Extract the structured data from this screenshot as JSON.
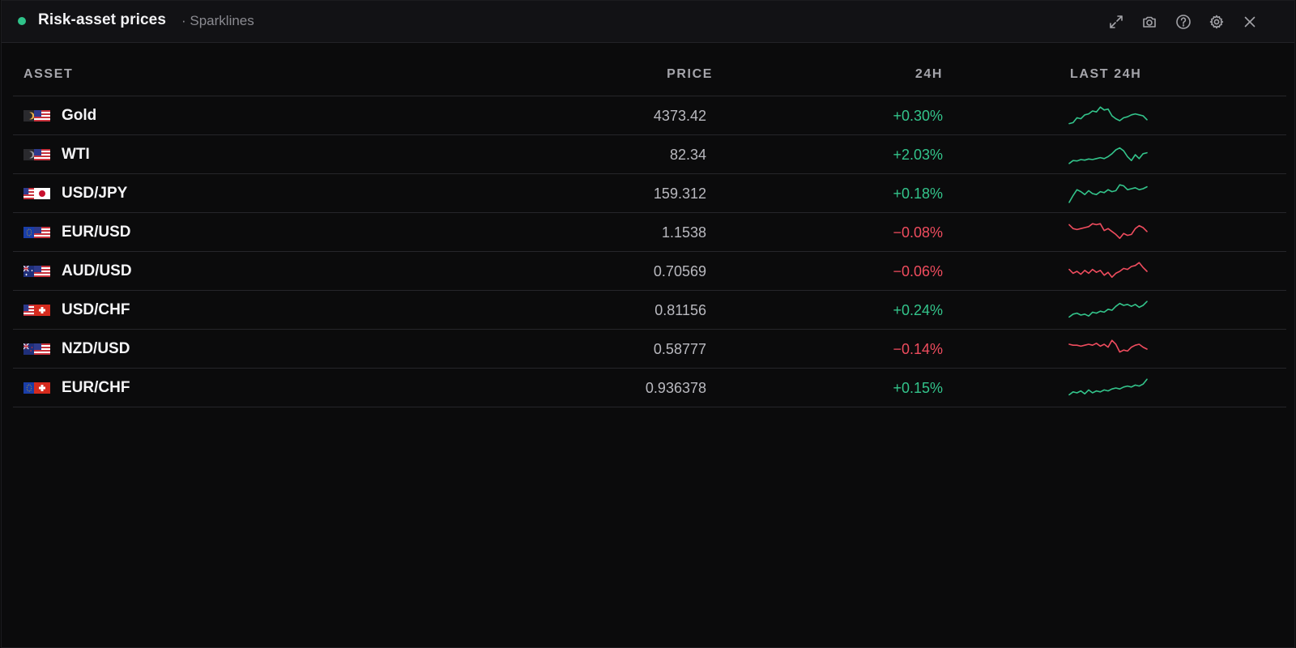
{
  "window": {
    "title": "Risk-asset prices",
    "subtitle": "· Sparklines",
    "status_color": "#2fc38a",
    "toolbar_icons": [
      "expand-icon",
      "camera-icon",
      "help-icon",
      "gear-icon",
      "close-icon"
    ]
  },
  "table": {
    "headers": {
      "asset": "ASSET",
      "price": "PRICE",
      "change": "24H",
      "spark": "LAST 24H"
    },
    "colors": {
      "up": "#33c48b",
      "down": "#ef4c5e"
    },
    "rows": [
      {
        "asset": "Gold",
        "price": "4373.42",
        "change": "+0.30%",
        "direction": "up",
        "flag": "xau-usd",
        "spark": [
          0.1,
          0.15,
          0.4,
          0.35,
          0.55,
          0.6,
          0.75,
          0.7,
          0.95,
          0.8,
          0.85,
          0.5,
          0.35,
          0.25,
          0.4,
          0.45,
          0.55,
          0.6,
          0.55,
          0.5,
          0.3
        ]
      },
      {
        "asset": "WTI",
        "price": "82.34",
        "change": "+2.03%",
        "direction": "up",
        "flag": "oil-usd",
        "spark": [
          0.05,
          0.2,
          0.18,
          0.25,
          0.22,
          0.28,
          0.25,
          0.3,
          0.35,
          0.3,
          0.4,
          0.55,
          0.75,
          0.85,
          0.7,
          0.4,
          0.2,
          0.5,
          0.3,
          0.55,
          0.6
        ]
      },
      {
        "asset": "USD/JPY",
        "price": "159.312",
        "change": "+0.18%",
        "direction": "up",
        "flag": "usd-jpy",
        "spark": [
          0.05,
          0.4,
          0.7,
          0.6,
          0.45,
          0.65,
          0.5,
          0.45,
          0.6,
          0.55,
          0.7,
          0.6,
          0.65,
          0.95,
          0.9,
          0.7,
          0.75,
          0.8,
          0.7,
          0.75,
          0.85
        ]
      },
      {
        "asset": "EUR/USD",
        "price": "1.1538",
        "change": "−0.08%",
        "direction": "down",
        "flag": "eur-usd",
        "spark": [
          0.9,
          0.7,
          0.65,
          0.7,
          0.75,
          0.8,
          0.95,
          0.9,
          0.95,
          0.6,
          0.7,
          0.55,
          0.4,
          0.2,
          0.45,
          0.35,
          0.4,
          0.7,
          0.85,
          0.75,
          0.55
        ]
      },
      {
        "asset": "AUD/USD",
        "price": "0.70569",
        "change": "−0.06%",
        "direction": "down",
        "flag": "aud-usd",
        "spark": [
          0.6,
          0.4,
          0.5,
          0.35,
          0.55,
          0.4,
          0.6,
          0.45,
          0.55,
          0.3,
          0.45,
          0.2,
          0.4,
          0.5,
          0.65,
          0.6,
          0.75,
          0.8,
          0.95,
          0.7,
          0.5
        ]
      },
      {
        "asset": "USD/CHF",
        "price": "0.81156",
        "change": "+0.24%",
        "direction": "up",
        "flag": "usd-chf",
        "spark": [
          0.15,
          0.3,
          0.35,
          0.25,
          0.3,
          0.2,
          0.4,
          0.35,
          0.45,
          0.4,
          0.55,
          0.5,
          0.7,
          0.85,
          0.75,
          0.8,
          0.7,
          0.8,
          0.65,
          0.75,
          0.95
        ]
      },
      {
        "asset": "NZD/USD",
        "price": "0.58777",
        "change": "−0.14%",
        "direction": "down",
        "flag": "nzd-usd",
        "spark": [
          0.75,
          0.7,
          0.7,
          0.65,
          0.7,
          0.75,
          0.7,
          0.8,
          0.65,
          0.75,
          0.6,
          0.95,
          0.75,
          0.35,
          0.45,
          0.4,
          0.6,
          0.7,
          0.75,
          0.6,
          0.5
        ]
      },
      {
        "asset": "EUR/CHF",
        "price": "0.936378",
        "change": "+0.15%",
        "direction": "up",
        "flag": "eur-chf",
        "spark": [
          0.15,
          0.3,
          0.25,
          0.35,
          0.2,
          0.4,
          0.25,
          0.35,
          0.3,
          0.4,
          0.35,
          0.45,
          0.5,
          0.45,
          0.55,
          0.6,
          0.55,
          0.65,
          0.6,
          0.7,
          0.95
        ]
      }
    ]
  }
}
